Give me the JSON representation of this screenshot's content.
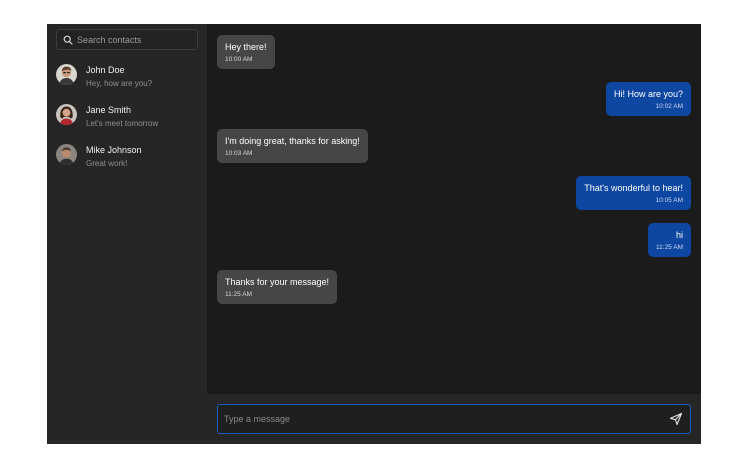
{
  "colors": {
    "page_background": "#ffffff",
    "app_background": "#1b1b1b",
    "sidebar_background": "#262626",
    "incoming_bubble": "#464646",
    "outgoing_bubble": "#0d47a1",
    "composer_border": "#1e5bbf"
  },
  "sidebar": {
    "search": {
      "icon": "search-icon",
      "placeholder": "Search contacts",
      "value": ""
    },
    "contacts": [
      {
        "name": "John Doe",
        "preview": "Hey, how are you?",
        "avatar": "avatar-photo"
      },
      {
        "name": "Jane Smith",
        "preview": "Let's meet tomorrow",
        "avatar": "avatar-photo"
      },
      {
        "name": "Mike Johnson",
        "preview": "Great work!",
        "avatar": "avatar-photo"
      }
    ]
  },
  "chat": {
    "messages": [
      {
        "direction": "incoming",
        "text": "Hey there!",
        "time": "10:00 AM"
      },
      {
        "direction": "outgoing",
        "text": "Hi! How are you?",
        "time": "10:02 AM"
      },
      {
        "direction": "incoming",
        "text": "I'm doing great, thanks for asking!",
        "time": "10:03 AM"
      },
      {
        "direction": "outgoing",
        "text": "That's wonderful to hear!",
        "time": "10:05 AM"
      },
      {
        "direction": "outgoing",
        "text": "hi",
        "time": "11:25 AM"
      },
      {
        "direction": "incoming",
        "text": "Thanks for your message!",
        "time": "11:25 AM"
      }
    ],
    "composer": {
      "placeholder": "Type a message",
      "value": "",
      "send_icon": "send-icon"
    }
  }
}
